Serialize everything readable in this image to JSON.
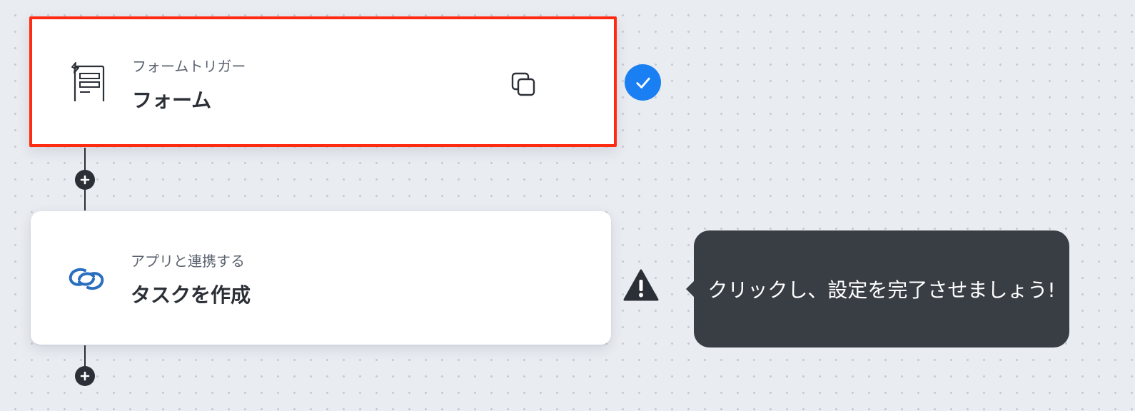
{
  "steps": [
    {
      "subtitle": "フォームトリガー",
      "title": "フォーム",
      "icon": "form-trigger-icon",
      "status": "complete",
      "status_icon": "check-icon",
      "action_icon": "copy-icon",
      "selected": true
    },
    {
      "subtitle": "アプリと連携する",
      "title": "タスクを作成",
      "icon": "app-link-icon",
      "status": "warning",
      "status_icon": "warning-icon",
      "selected": false
    }
  ],
  "tooltip": {
    "text": "クリックし、設定を完了させましょう!"
  },
  "colors": {
    "selected_border": "#ff2a12",
    "complete": "#1a7ff2",
    "app_icon": "#2a6fbf",
    "tooltip_bg": "#393d44",
    "canvas_bg": "#e9ecf1"
  }
}
